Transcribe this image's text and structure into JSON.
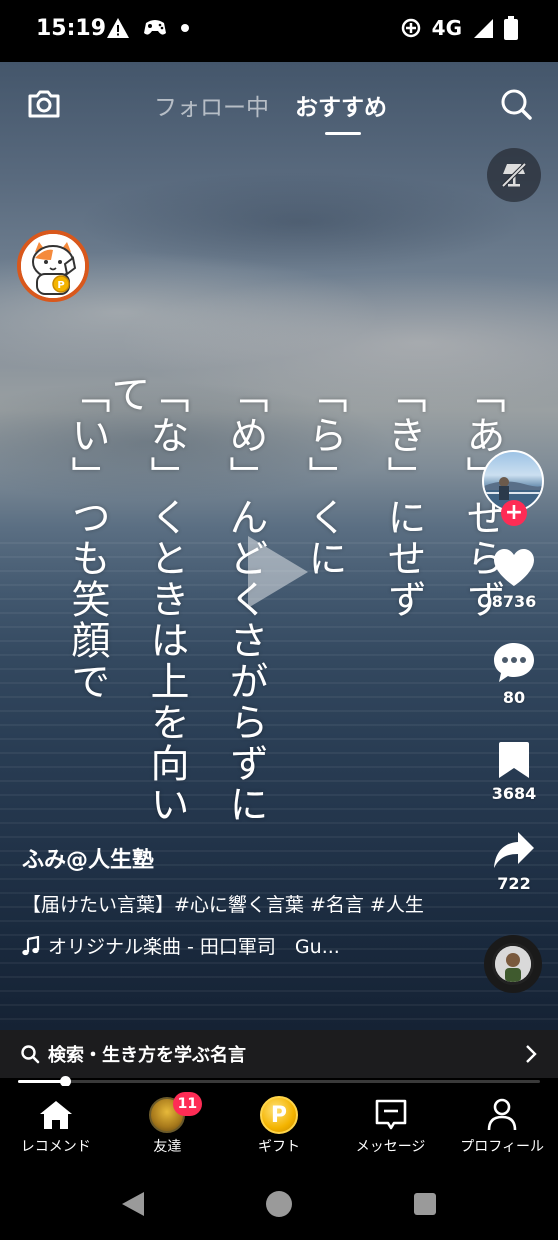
{
  "status_bar": {
    "time": "15:19",
    "network": "4G",
    "icons": [
      "warning-icon",
      "game-controller-icon",
      "dot-icon",
      "data-saver-icon",
      "signal-icon",
      "battery-icon"
    ]
  },
  "top_nav": {
    "tabs": [
      {
        "label": "フォロー中",
        "active": false
      },
      {
        "label": "おすすめ",
        "active": true
      }
    ]
  },
  "poem": {
    "columns": [
      "「あ」せらず",
      "「き」にせず",
      "「ら」くに",
      "「め」んどくさがらずに",
      "「な」くときは上を向いて",
      "「い」つも笑顔で"
    ]
  },
  "actions": {
    "likes": "8736",
    "comments": "80",
    "bookmarks": "3684",
    "shares": "722"
  },
  "caption": {
    "username": "ふみ@人生塾",
    "description": "【届けたい言葉】#心に響く言葉 #名言 #人生",
    "music": "オリジナル楽曲 - 田口軍司　Gu..."
  },
  "search_suggestion": {
    "label": "検索・生き方を学ぶ名言"
  },
  "playback": {
    "progress": 0.09
  },
  "bottom_nav": {
    "items": [
      {
        "label": "レコメンド",
        "icon": "home-icon"
      },
      {
        "label": "友達",
        "icon": "friends-avatar",
        "badge": "11"
      },
      {
        "label": "ギフト",
        "icon": "coin-icon"
      },
      {
        "label": "メッセージ",
        "icon": "message-icon"
      },
      {
        "label": "プロフィール",
        "icon": "profile-icon"
      }
    ]
  },
  "colors": {
    "accent": "#fe2c55",
    "coin": "#f4b400",
    "badge_ring": "#d9581c"
  }
}
